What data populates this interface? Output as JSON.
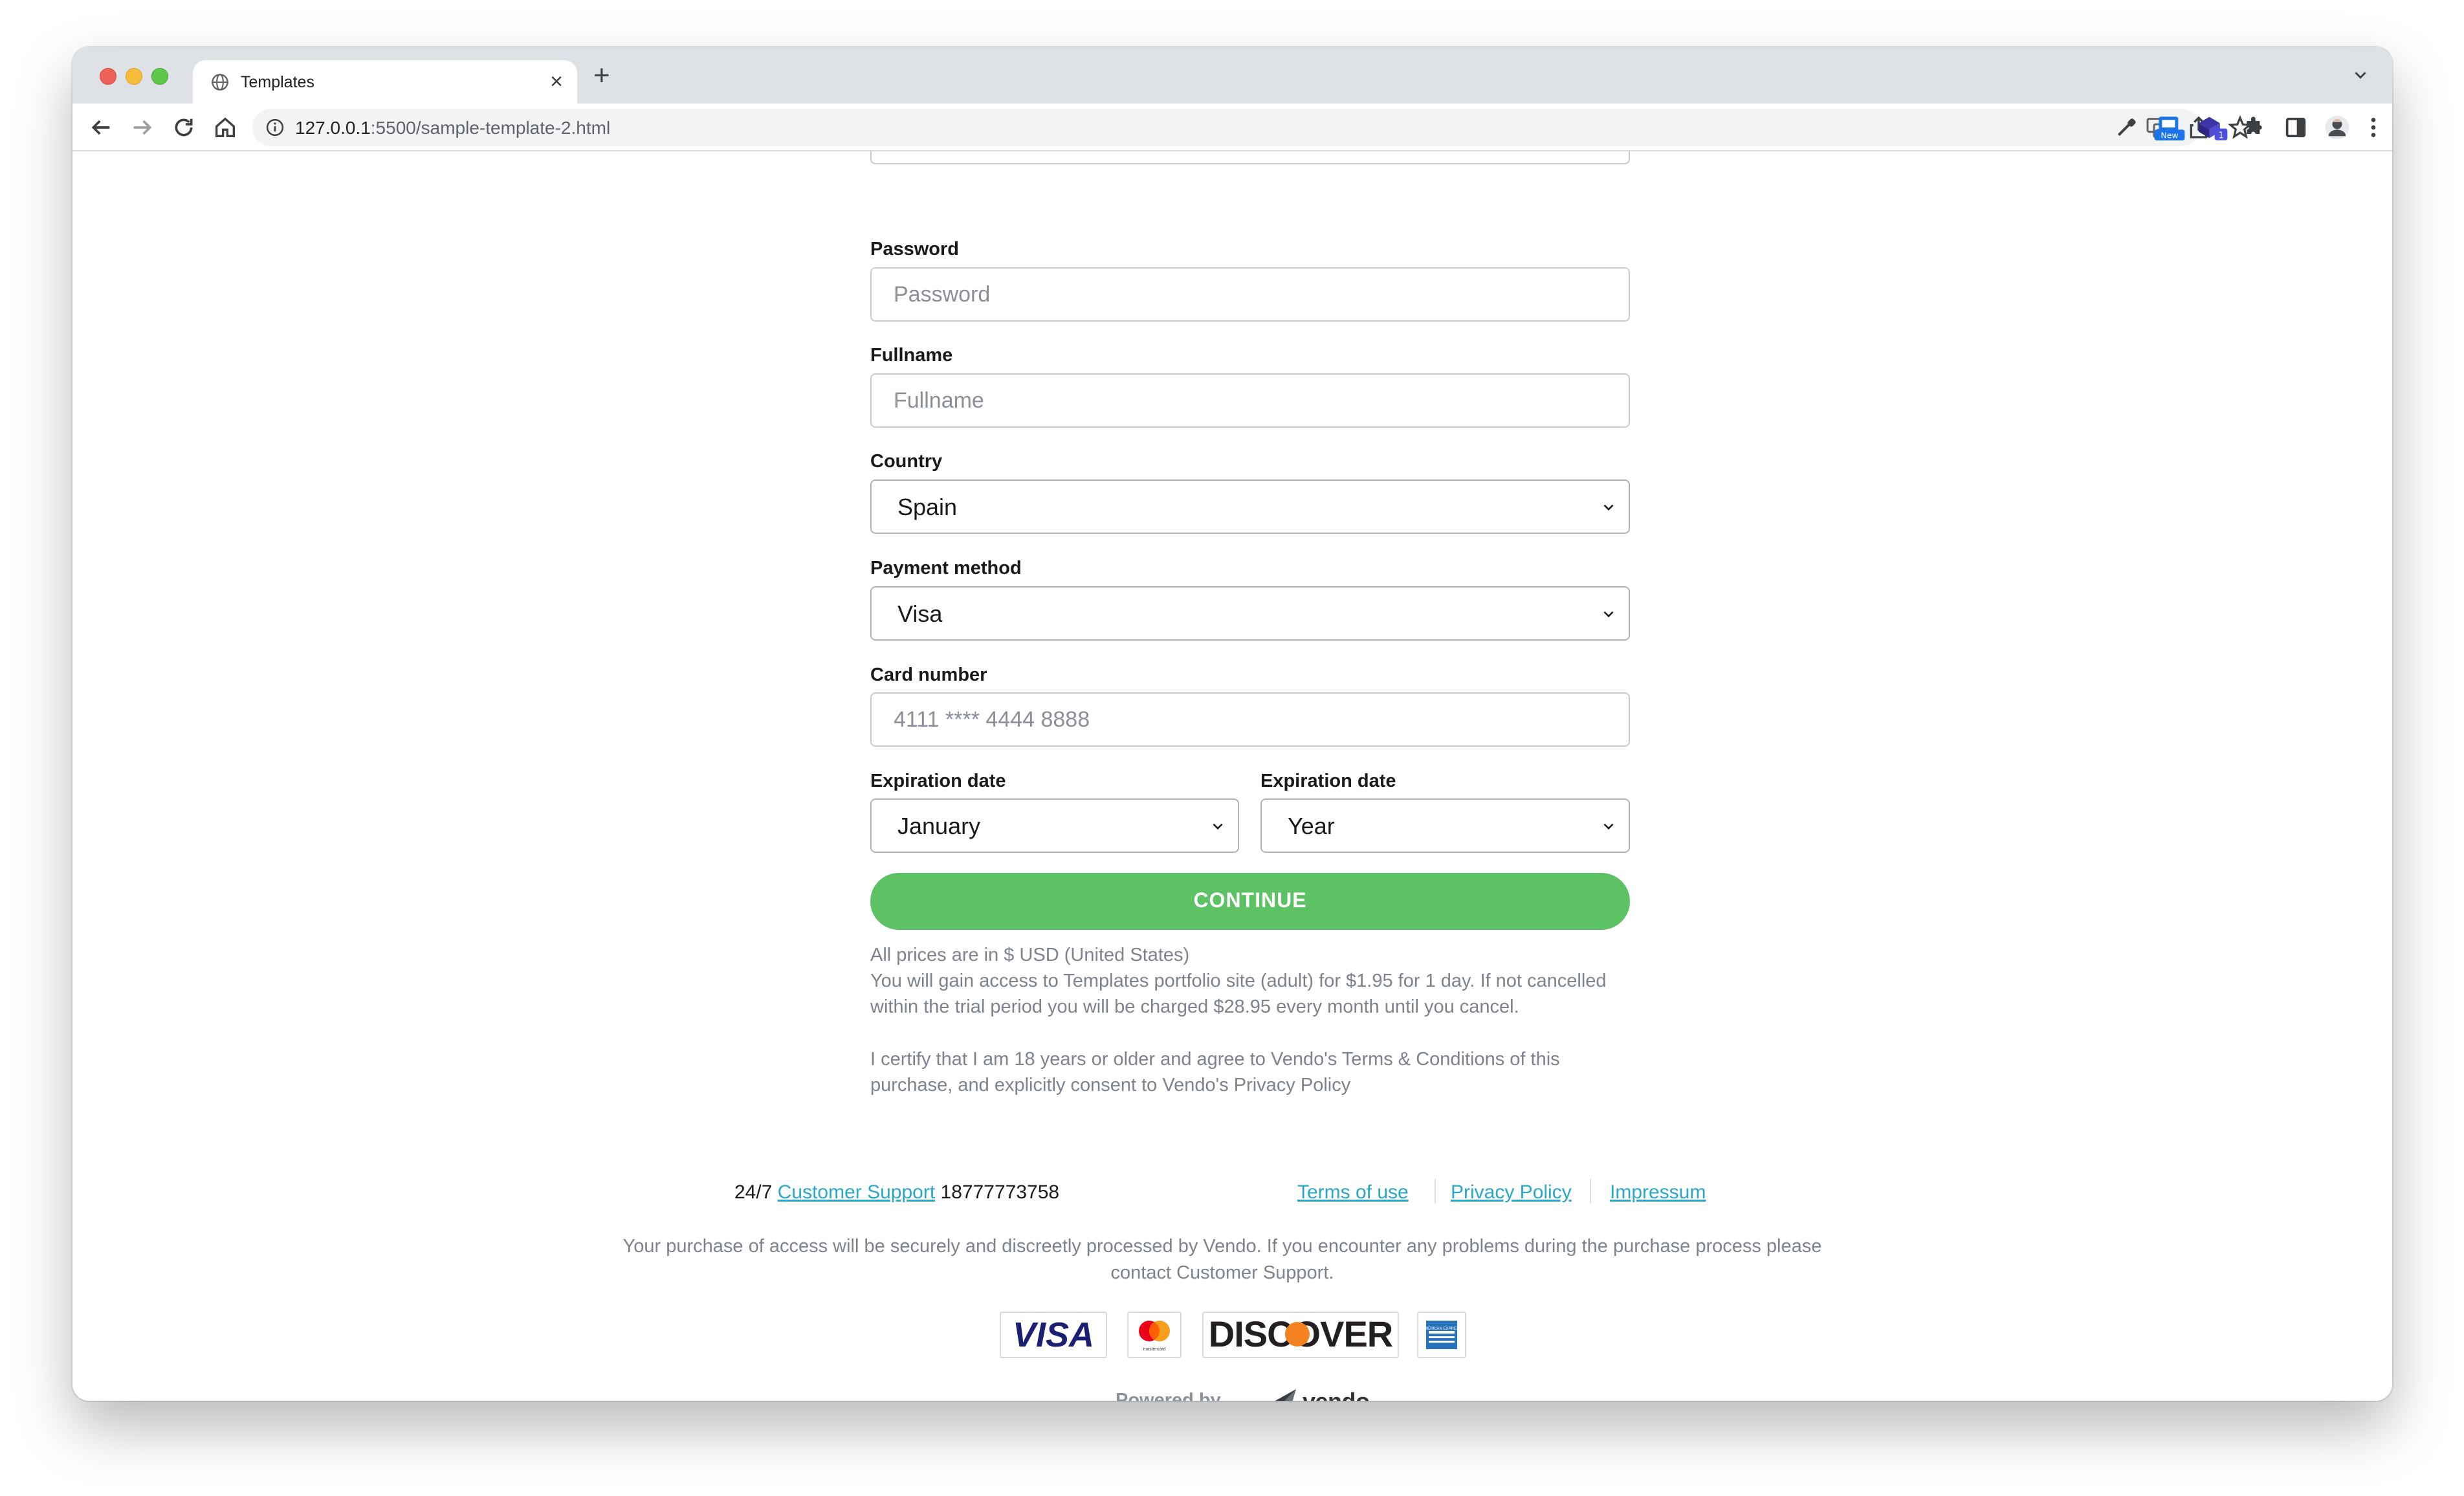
{
  "browser": {
    "tab_title": "Templates",
    "url_host": "127.0.0.1",
    "url_rest": ":5500/sample-template-2.html",
    "extension_badge_new": "New",
    "extension_badge_count": "1"
  },
  "form": {
    "password": {
      "label": "Password",
      "placeholder": "Password"
    },
    "fullname": {
      "label": "Fullname",
      "placeholder": "Fullname"
    },
    "country": {
      "label": "Country",
      "value": "Spain"
    },
    "payment_method": {
      "label": "Payment method",
      "value": "Visa"
    },
    "card_number": {
      "label": "Card number",
      "placeholder": "4111 **** 4444 8888"
    },
    "expiration_month": {
      "label": "Expiration date",
      "value": "January"
    },
    "expiration_year": {
      "label": "Expiration date",
      "value": "Year"
    },
    "continue_label": "CONTINUE"
  },
  "disclaimer": {
    "prices": "All prices are in $ USD (United States)",
    "trial": "You will gain access to Templates portfolio site (adult) for $1.95 for 1 day. If not cancelled within the trial period you will be charged $28.95 every month until you cancel.",
    "certify": "I certify that I am 18 years or older and agree to Vendo's Terms & Conditions of this purchase, and explicitly consent to Vendo's Privacy Policy"
  },
  "footer": {
    "support_prefix": "24/7",
    "support_link": "Customer Support",
    "support_phone": "18777773758",
    "terms": "Terms of use",
    "privacy": "Privacy Policy",
    "impressum": "Impressum",
    "secure_text": "Your purchase of access will be securely and discreetly processed by Vendo. If you encounter any problems during the purchase process please contact Customer Support.",
    "cards": {
      "visa": "VISA",
      "mastercard": "mastercard",
      "discover": "DISCOVER",
      "amex": "AMERICAN EXPRESS"
    },
    "powered_by": "Powered by",
    "vendo": "vendo"
  },
  "colors": {
    "accent_green": "#5cc264",
    "link_blue": "#2aa6c7",
    "visa_blue": "#1a1f71",
    "discover_orange": "#f58220",
    "amex_blue": "#2671b9"
  },
  "icons": [
    "globe-icon",
    "close-icon",
    "plus-icon",
    "chevron-down-icon",
    "back-arrow-icon",
    "forward-arrow-icon",
    "reload-icon",
    "home-icon",
    "info-icon",
    "translate-icon",
    "share-icon",
    "star-icon",
    "eyedropper-icon",
    "extension-new-icon",
    "extension-badge-icon",
    "puzzle-icon",
    "sidepanel-icon",
    "profile-avatar-icon",
    "kebab-menu-icon"
  ]
}
